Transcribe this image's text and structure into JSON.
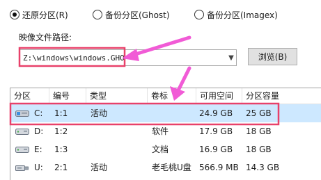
{
  "options": {
    "restore": "还原分区(R)",
    "backup_ghost": "备份分区(Ghost)",
    "backup_imagex": "备份分区(Imagex)"
  },
  "path": {
    "label": "映像文件路径:",
    "value": "Z:\\windows\\windows.GHO",
    "browse": "浏览(B)"
  },
  "table": {
    "headers": [
      "分区",
      "编号",
      "类型",
      "卷标",
      "可用空间",
      "分区容量"
    ],
    "rows": [
      {
        "drive": "C:",
        "number": "1:1",
        "type": "活动",
        "label": "",
        "free": "24.9 GB",
        "capacity": "25 GB",
        "selected": true,
        "icon": "drive-system-icon"
      },
      {
        "drive": "D:",
        "number": "1:2",
        "type": "",
        "label": "软件",
        "free": "17.9 GB",
        "capacity": "18 GB",
        "selected": false,
        "icon": "drive-icon"
      },
      {
        "drive": "E:",
        "number": "1:3",
        "type": "",
        "label": "文档",
        "free": "16.9 GB",
        "capacity": "18 GB",
        "selected": false,
        "icon": "drive-icon"
      },
      {
        "drive": "U:",
        "number": "2:1",
        "type": "活动",
        "label": "老毛桃U盘",
        "free": "566.9 MB",
        "capacity": "14.3 GB",
        "selected": false,
        "icon": "usb-drive-icon"
      }
    ]
  },
  "colors": {
    "annotation": "#e8416a",
    "arrow": "#f15bd6",
    "selection": "#cde8ff"
  }
}
